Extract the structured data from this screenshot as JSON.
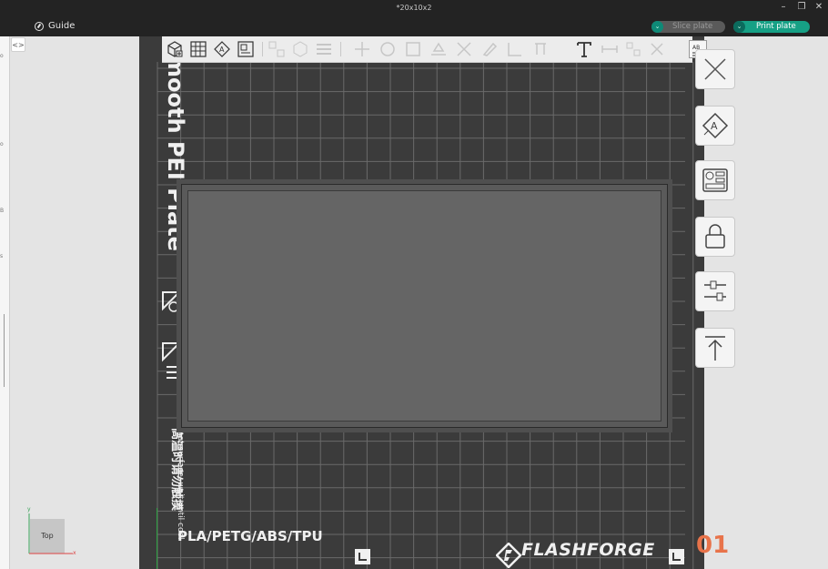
{
  "window": {
    "title": "*20x10x2",
    "controls": {
      "minimize": "–",
      "maximize": "❐",
      "close": "✕"
    }
  },
  "menubar": {
    "guide_label": "Guide",
    "slice_label": "Slice plate",
    "print_label": "Print plate"
  },
  "view": {
    "cube_label": "Top",
    "axis_y": "y",
    "axis_x": "x"
  },
  "plate": {
    "vertical_label": "mooth PEI Plate",
    "materials": "PLA/PETG/ABS/TPU",
    "brand": "FLASHFORGE",
    "plate_number": "01",
    "warning_en": "Warning: hot surface, wait until cool",
    "warning_cn": "高温时请勿触摸"
  },
  "colors": {
    "accent": "#16a085",
    "plate_number": "#e8734a",
    "plate_bg": "#3b3b3b"
  },
  "toolbar": {
    "icons": [
      "add-object-icon",
      "arrange-grid-icon",
      "auto-orient-icon",
      "plate-layout-icon",
      "split-object-icon",
      "split-parts-icon",
      "layers-icon",
      "move-icon",
      "rotate-icon",
      "scale-icon",
      "lay-on-face-icon",
      "cut-icon",
      "paint-icon",
      "seam-icon",
      "text-icon",
      "measure-icon",
      "assembly-icon",
      "view-settings-icon"
    ]
  },
  "sidebar": {
    "buttons": [
      "close-plate-icon",
      "auto-orient-plate-icon",
      "arrange-plate-icon",
      "lock-plate-icon",
      "plate-settings-icon",
      "move-to-top-icon"
    ]
  }
}
